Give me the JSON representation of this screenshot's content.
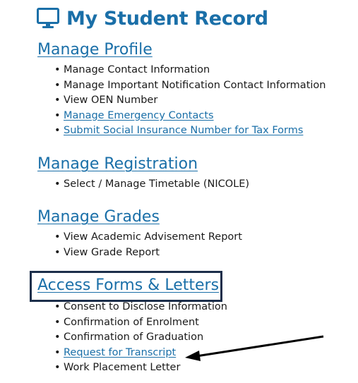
{
  "page": {
    "title": "My Student Record",
    "title_color": "#1a6fa8",
    "highlight_box_color": "#1c2e4a",
    "arrow_color": "#000000"
  },
  "sections": [
    {
      "heading": "Manage Profile",
      "items": [
        {
          "label": "Manage Contact Information",
          "link": false
        },
        {
          "label": "Manage Important Notification Contact Information",
          "link": false
        },
        {
          "label": "View OEN Number",
          "link": false
        },
        {
          "label": "Manage Emergency Contacts",
          "link": true
        },
        {
          "label": "Submit Social Insurance Number for Tax Forms",
          "link": true
        }
      ]
    },
    {
      "heading": "Manage Registration",
      "items": [
        {
          "label": "Select / Manage Timetable (NICOLE)",
          "link": false
        }
      ]
    },
    {
      "heading": "Manage Grades",
      "items": [
        {
          "label": "View Academic Advisement Report",
          "link": false
        },
        {
          "label": "View Grade Report",
          "link": false
        }
      ]
    },
    {
      "heading": "Access Forms & Letters",
      "items": [
        {
          "label": "Consent to Disclose Information",
          "link": false
        },
        {
          "label": "Confirmation of Enrolment",
          "link": false
        },
        {
          "label": "Confirmation of Graduation",
          "link": false
        },
        {
          "label": "Request for Transcript",
          "link": true
        },
        {
          "label": "Work Placement Letter",
          "link": false
        }
      ]
    }
  ],
  "icons": {
    "title_icon": "monitor-icon",
    "annotation": "arrow-icon"
  }
}
